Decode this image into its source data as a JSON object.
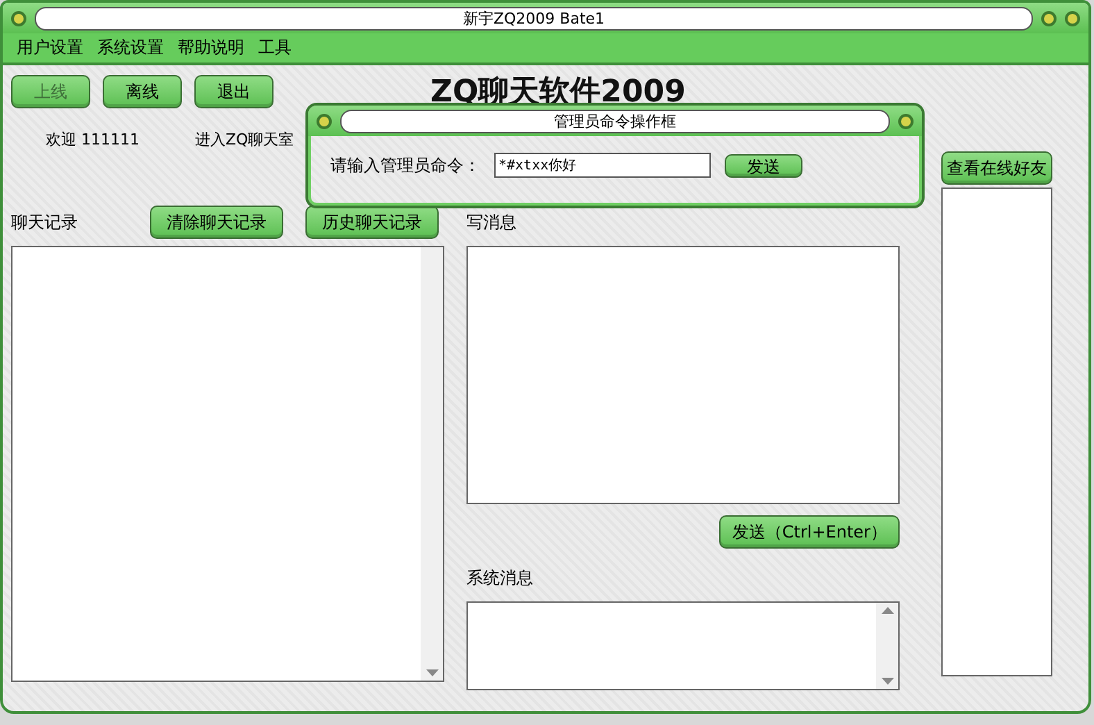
{
  "window": {
    "title": "新宇ZQ2009 Bate1"
  },
  "menu": [
    "用户设置",
    "系统设置",
    "帮助说明",
    "工具"
  ],
  "toolbar_buttons": [
    {
      "label": "上线",
      "disabled": true
    },
    {
      "label": "离线",
      "disabled": false
    },
    {
      "label": "退出",
      "disabled": false
    }
  ],
  "headline": "ZQ聊天软件2009",
  "welcome": {
    "greeting": "欢迎",
    "user": "111111",
    "status": "进入ZQ聊天室"
  },
  "chat_log": {
    "label": "聊天记录",
    "buttons": [
      "清除聊天记录",
      "历史聊天记录"
    ]
  },
  "compose": {
    "label": "写消息",
    "send_button": "发送（Ctrl+Enter）"
  },
  "system_messages": {
    "label": "系统消息"
  },
  "friends": {
    "button": "查看在线好友"
  },
  "admin_dialog": {
    "title": "管理员命令操作框",
    "prompt": "请输入管理员命令：",
    "value": "*#xtxx你好",
    "send_button": "发送"
  }
}
